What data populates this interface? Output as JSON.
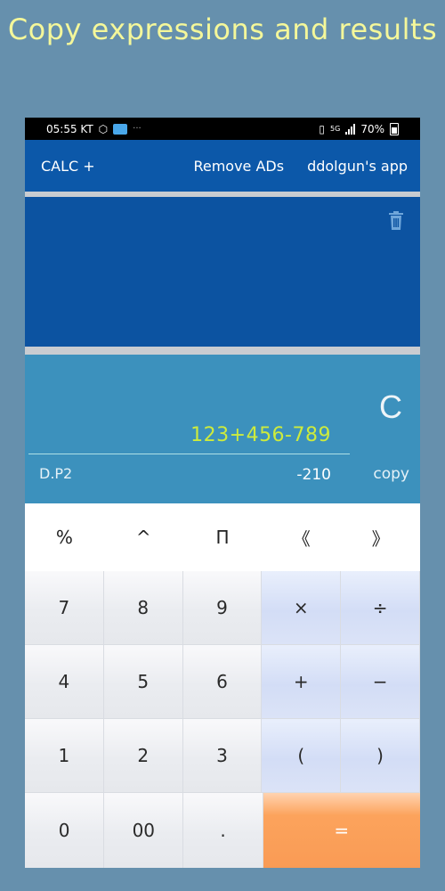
{
  "promo": {
    "title": "Copy expressions and results"
  },
  "statusbar": {
    "time": "05:55 KT",
    "dots": "···",
    "net": "5G",
    "battery": "70%"
  },
  "appbar": {
    "title": "CALC +",
    "remove_ads": "Remove ADs",
    "dev_app": "ddolgun's app"
  },
  "display": {
    "clear": "C",
    "expression": "123+456-789",
    "dp_label": "D.P2",
    "result": "-210",
    "copy_label": "copy"
  },
  "keys": {
    "row1": [
      "%",
      "^",
      "Π",
      "《",
      "》"
    ],
    "row2": [
      "7",
      "8",
      "9",
      "×",
      "÷"
    ],
    "row3": [
      "4",
      "5",
      "6",
      "+",
      "−"
    ],
    "row4": [
      "1",
      "2",
      "3",
      "(",
      ")"
    ],
    "row5": [
      "0",
      "00",
      ".",
      "="
    ]
  },
  "colors": {
    "background": "#6690ad",
    "promo_text": "#f4f79a",
    "appbar": "#0c58a9",
    "history": "#0c53a1",
    "display": "#3c91bd",
    "expression": "#cdeb3d",
    "equals": "#f99b55"
  },
  "icons": {
    "trash": "trash-icon"
  }
}
